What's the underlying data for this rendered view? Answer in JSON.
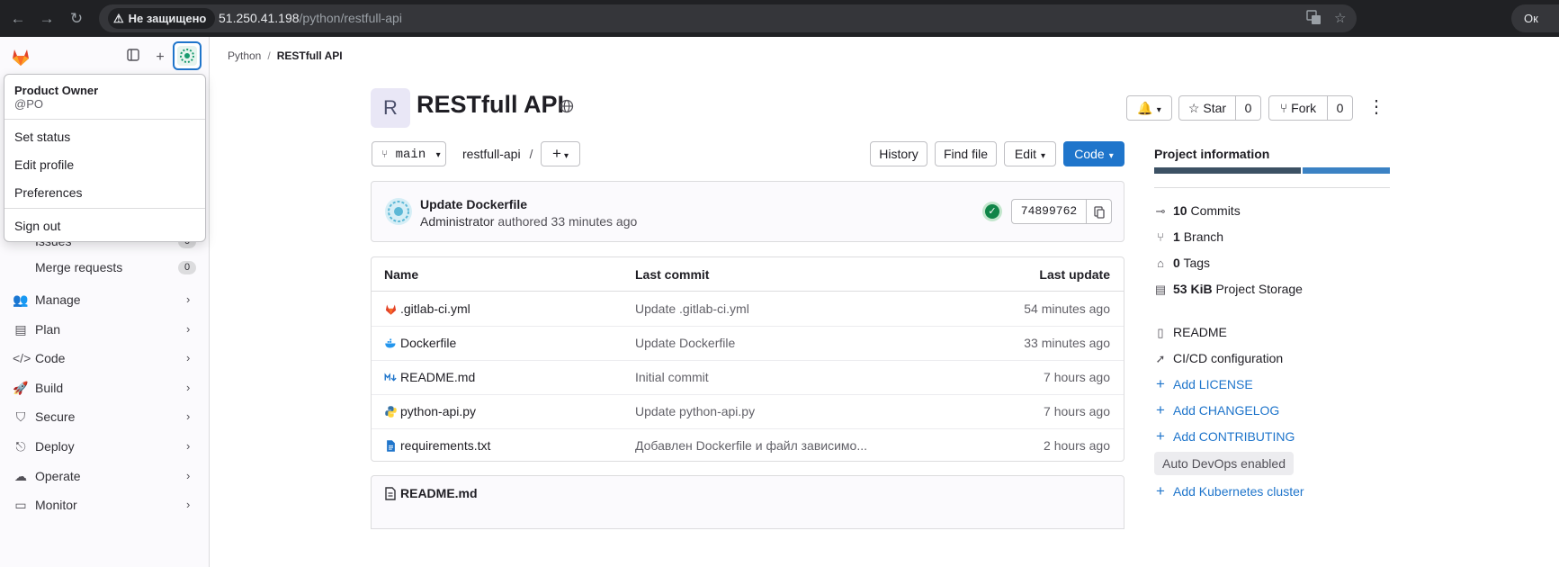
{
  "browser": {
    "security_label": "Не защищено",
    "url_host": "51.250.41.198",
    "url_path": "/python/restfull-api",
    "profile_label": "Ок"
  },
  "sidebar": {
    "user_menu": {
      "name": "Product Owner",
      "handle": "@PO",
      "items": [
        "Set status",
        "Edit profile",
        "Preferences",
        "Sign out"
      ]
    },
    "partial_item": {
      "label": "Issues",
      "count": "0"
    },
    "merge_requests": {
      "label": "Merge requests",
      "count": "0"
    },
    "sections": [
      {
        "label": "Manage",
        "icon": "users-icon"
      },
      {
        "label": "Plan",
        "icon": "plan-icon"
      },
      {
        "label": "Code",
        "icon": "code-icon"
      },
      {
        "label": "Build",
        "icon": "rocket-icon"
      },
      {
        "label": "Secure",
        "icon": "shield-icon"
      },
      {
        "label": "Deploy",
        "icon": "deploy-icon"
      },
      {
        "label": "Operate",
        "icon": "cloud-icon"
      },
      {
        "label": "Monitor",
        "icon": "monitor-icon"
      }
    ]
  },
  "breadcrumb": {
    "parent": "Python",
    "current": "RESTfull API"
  },
  "project": {
    "avatar_letter": "R",
    "title": "RESTfull API",
    "star_label": "Star",
    "star_count": "0",
    "fork_label": "Fork",
    "fork_count": "0"
  },
  "toolbar": {
    "branch": "main",
    "path": "restfull-api",
    "path_sep": "/",
    "history": "History",
    "find_file": "Find file",
    "edit": "Edit",
    "code": "Code"
  },
  "last_commit": {
    "title": "Update Dockerfile",
    "author": "Administrator",
    "action": "authored",
    "time": "33 minutes ago",
    "sha": "74899762",
    "pipeline_status": "passed"
  },
  "file_table": {
    "headers": {
      "name": "Name",
      "last_commit": "Last commit",
      "last_update": "Last update"
    },
    "rows": [
      {
        "name": ".gitlab-ci.yml",
        "icon": "gitlab-icon",
        "commit": "Update .gitlab-ci.yml",
        "updated": "54 minutes ago"
      },
      {
        "name": "Dockerfile",
        "icon": "docker-icon",
        "commit": "Update Dockerfile",
        "updated": "33 minutes ago"
      },
      {
        "name": "README.md",
        "icon": "markdown-icon",
        "commit": "Initial commit",
        "updated": "7 hours ago"
      },
      {
        "name": "python-api.py",
        "icon": "python-icon",
        "commit": "Update python-api.py",
        "updated": "7 hours ago"
      },
      {
        "name": "requirements.txt",
        "icon": "text-file-icon",
        "commit": "Добавлен Dockerfile и файл зависимо...",
        "updated": "2 hours ago"
      }
    ]
  },
  "readme": {
    "title": "README.md"
  },
  "project_info": {
    "title": "Project information",
    "language_bar": {
      "colors": [
        "#3c5164",
        "#3b82c4"
      ],
      "shares": [
        0.63,
        0.37
      ]
    },
    "stats": [
      {
        "count": "10",
        "label": "Commits",
        "icon": "commit-icon"
      },
      {
        "count": "1",
        "label": "Branch",
        "icon": "branch-icon"
      },
      {
        "count": "0",
        "label": "Tags",
        "icon": "tag-icon"
      },
      {
        "count": "53 KiB",
        "label": "Project Storage",
        "icon": "storage-icon"
      }
    ],
    "links": [
      {
        "label": "README",
        "icon": "file-icon",
        "type": "existing"
      },
      {
        "label": "CI/CD configuration",
        "icon": "rocket-icon",
        "type": "existing"
      },
      {
        "label": "Add LICENSE",
        "icon": "plus-icon",
        "type": "add"
      },
      {
        "label": "Add CHANGELOG",
        "icon": "plus-icon",
        "type": "add"
      },
      {
        "label": "Add CONTRIBUTING",
        "icon": "plus-icon",
        "type": "add"
      }
    ],
    "auto_devops": "Auto DevOps enabled",
    "kubernetes": "Add Kubernetes cluster"
  }
}
